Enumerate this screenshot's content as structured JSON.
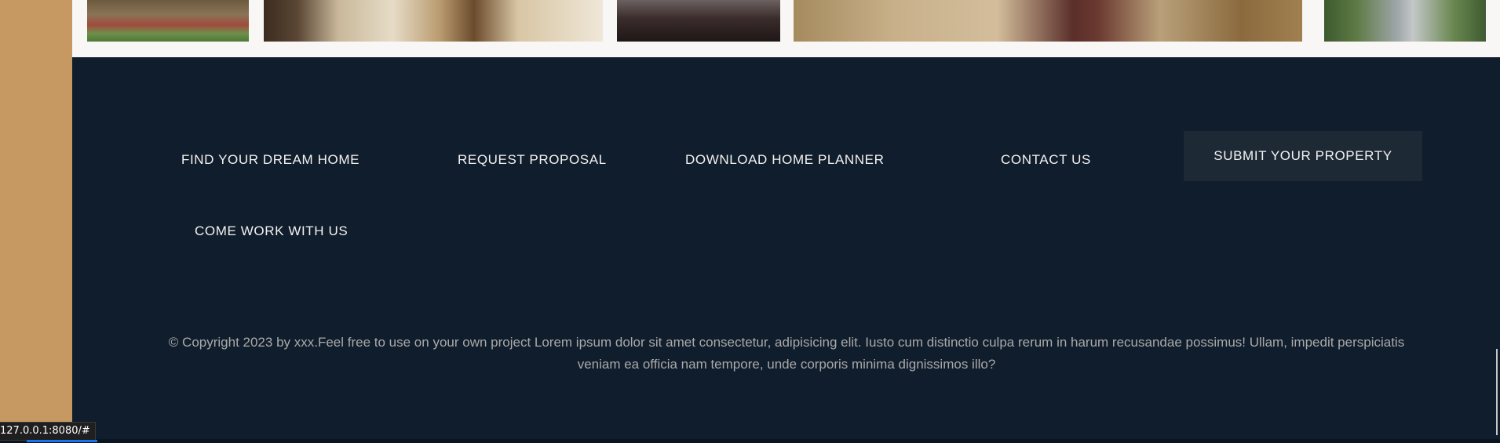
{
  "gallery": {
    "images": [
      "house-exterior",
      "dining-room",
      "dark-bed",
      "hall-table",
      "garden-path"
    ]
  },
  "footer": {
    "nav": {
      "find_dream_home": "FIND YOUR DREAM HOME",
      "request_proposal": "REQUEST PROPOSAL",
      "download_planner": "DOWNLOAD HOME PLANNER",
      "contact_us": "CONTACT US",
      "submit_property": "SUBMIT YOUR PROPERTY",
      "come_work": "COME WORK WITH US"
    },
    "copyright": "© Copyright 2023 by xxx.Feel free to use on your own project Lorem ipsum dolor sit amet consectetur, adipisicing elit. Iusto cum distinctio culpa rerum in harum recusandae possimus! Ullam, impedit perspiciatis veniam ea officia nam tempore, unde corporis minima dignissimos illo?"
  },
  "status_bar": {
    "url": "127.0.0.1:8080/#"
  },
  "colors": {
    "accent_tan": "#c69963",
    "footer_bg": "#101d2c",
    "button_bg": "#1d2935",
    "text_light": "#f4f2f2",
    "text_muted": "#aaa9a9"
  }
}
